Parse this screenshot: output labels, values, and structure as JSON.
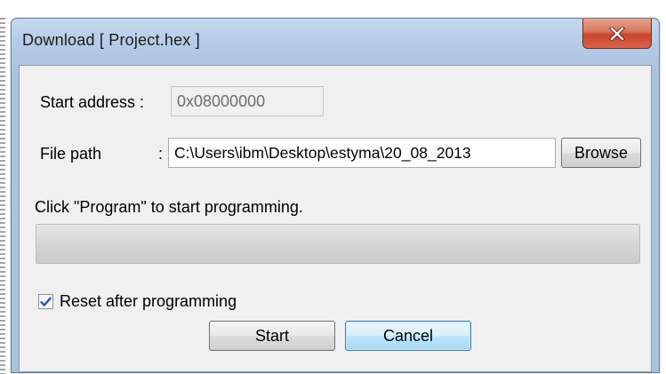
{
  "window": {
    "title": "Download [ Project.hex ]",
    "close_symbol": "X"
  },
  "form": {
    "start_address_label": "Start address :",
    "start_address_value": "0x08000000",
    "file_path_label": "File path",
    "file_path_colon": ":",
    "file_path_value": "C:\\Users\\ibm\\Desktop\\estyma\\20_08_2013",
    "browse_label": "Browse",
    "status_text": "Click \"Program\" to start programming."
  },
  "progress": {
    "value_percent": 0
  },
  "options": {
    "reset_label": "Reset after programming",
    "reset_checked": true
  },
  "buttons": {
    "start_label": "Start",
    "cancel_label": "Cancel"
  },
  "icons": {
    "close": "close-icon",
    "check": "checkmark-icon"
  },
  "colors": {
    "titlebar": "#b4cbe6",
    "close_button": "#c9452b",
    "client_background": "#f0f0f0",
    "focus_button": "#bee6fd"
  }
}
